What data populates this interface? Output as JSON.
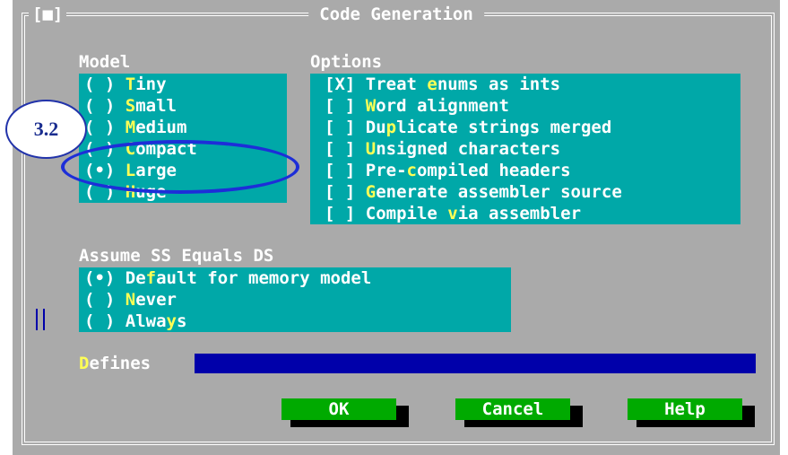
{
  "window": {
    "title": "Code Generation",
    "close_glyph": "[■]"
  },
  "model": {
    "heading": "Model",
    "items": [
      {
        "pre": "( ) ",
        "hot": "T",
        "post": "iny"
      },
      {
        "pre": "( ) ",
        "hot": "S",
        "post": "mall"
      },
      {
        "pre": "( ) ",
        "hot": "M",
        "post": "edium"
      },
      {
        "pre": "( ) ",
        "hot": "C",
        "post": "ompact"
      },
      {
        "pre": "(•) ",
        "hot": "L",
        "post": "arge"
      },
      {
        "pre": "( ) ",
        "hot": "H",
        "post": "uge"
      }
    ],
    "selected_index": 4
  },
  "options": {
    "heading": "Options",
    "items": [
      {
        "pre": "[X] Treat ",
        "hot": "e",
        "post": "nums as ints"
      },
      {
        "pre": "[ ] ",
        "hot": "W",
        "post": "ord alignment"
      },
      {
        "pre": "[ ] Du",
        "hot": "p",
        "post": "licate strings merged"
      },
      {
        "pre": "[ ] ",
        "hot": "U",
        "post": "nsigned characters"
      },
      {
        "pre": "[ ] Pre-",
        "hot": "c",
        "post": "ompiled headers"
      },
      {
        "pre": "[ ] ",
        "hot": "G",
        "post": "enerate assembler source"
      },
      {
        "pre": "[ ] Compile ",
        "hot": "v",
        "post": "ia assembler"
      }
    ]
  },
  "ssds": {
    "heading": "Assume SS Equals DS",
    "items": [
      {
        "pre": "(•) De",
        "hot": "f",
        "post": "ault for memory model"
      },
      {
        "pre": "( ) ",
        "hot": "N",
        "post": "ever"
      },
      {
        "pre": "( ) Alwa",
        "hot": "y",
        "post": "s"
      }
    ]
  },
  "defines": {
    "hot": "D",
    "post": "efines",
    "value": ""
  },
  "buttons": {
    "ok": "OK",
    "cancel": "Cancel",
    "help": "Help"
  },
  "annotation": {
    "label": "3.2"
  },
  "colors": {
    "dialog_bg": "#aaaaaa",
    "panel": "#00a8a8",
    "hotkey": "#ffff55",
    "button": "#00aa00",
    "input": "#0000aa",
    "annotation": "#1d2ed8"
  }
}
